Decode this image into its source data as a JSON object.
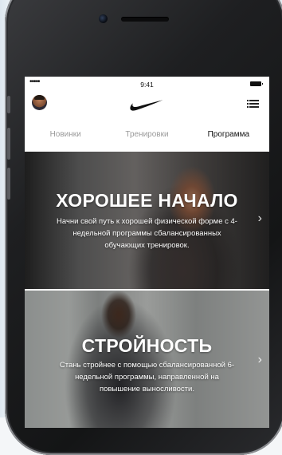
{
  "status_bar": {
    "signal": "•••••",
    "time": "9:41"
  },
  "header": {
    "logo": "nike-swoosh-icon",
    "menu_icon": "list-menu-icon"
  },
  "tabs": [
    {
      "label": "Новинки",
      "active": false
    },
    {
      "label": "Тренировки",
      "active": false
    },
    {
      "label": "Программа",
      "active": true
    }
  ],
  "cards": [
    {
      "title": "ХОРОШЕЕ НАЧАЛО",
      "description": "Начни свой путь к хорошей физической форме с 4-недельной программы сбалансированных обучающих тренировок.",
      "chevron": "›"
    },
    {
      "title": "СТРОЙНОСТЬ",
      "description": "Стань стройнее с помощью сбалансированной 6-недельной программы, направленной на повышение выносливости.",
      "chevron": "›"
    }
  ],
  "colors": {
    "tab_active": "#111111",
    "tab_inactive": "#9a9a9a",
    "screen_bg": "#ffffff"
  }
}
